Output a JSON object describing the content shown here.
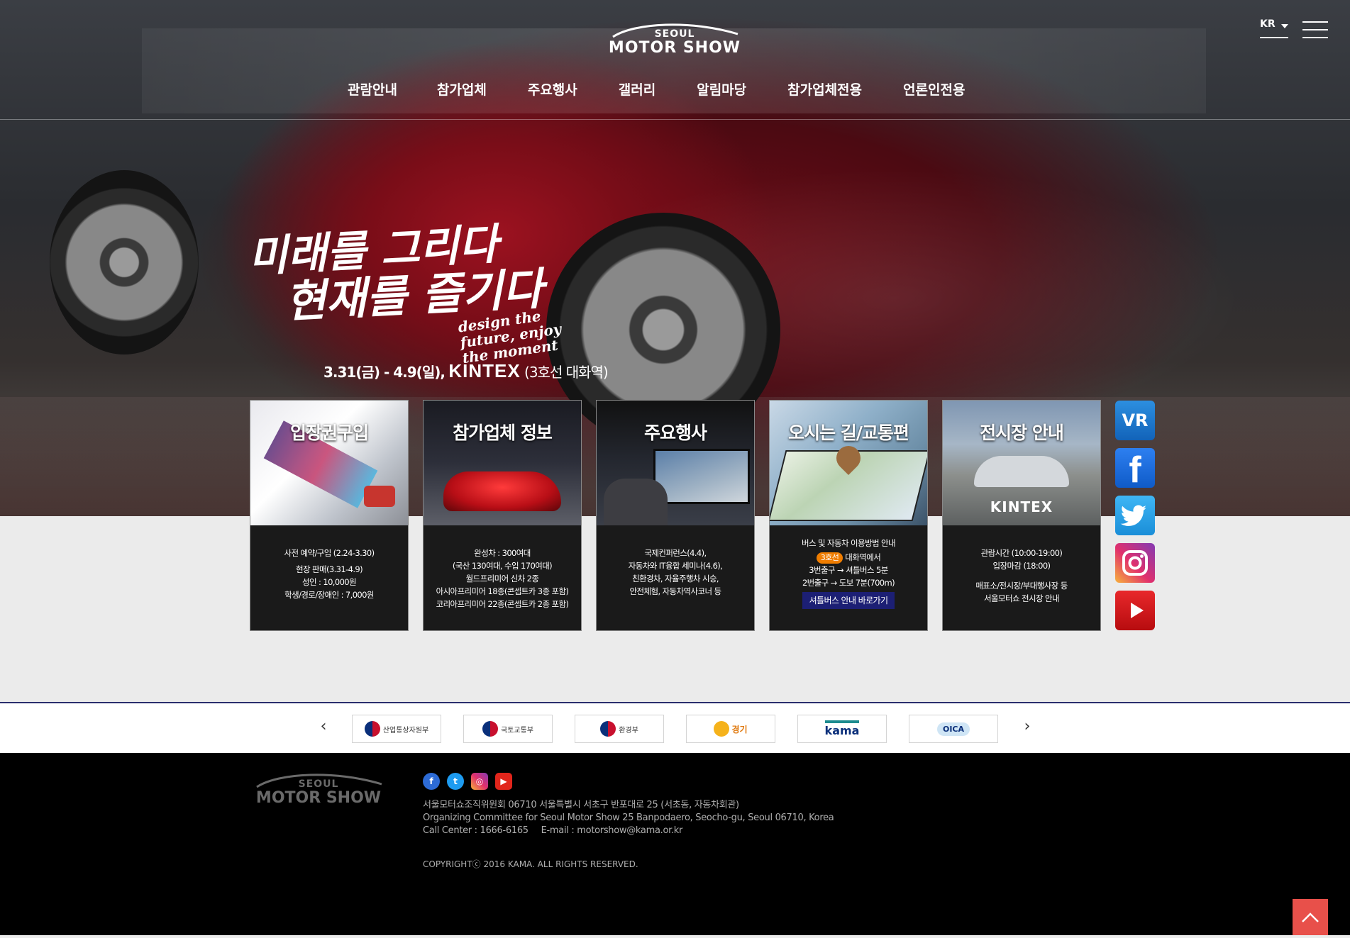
{
  "header": {
    "logo_top": "SEOUL",
    "logo_bottom": "MOTOR SHOW",
    "lang": "KR",
    "nav": [
      "관람안내",
      "참가업체",
      "주요행사",
      "갤러리",
      "알림마당",
      "참가업체전용",
      "언론인전용"
    ]
  },
  "hero": {
    "tagline_line1": "미래를 그리다",
    "tagline_line2": "현재를 즐기다",
    "tagline_en": "design the future, enjoy the moment",
    "date_text": "3.31(금) - 4.9(일),",
    "venue": "KINTEX",
    "venue_note": "(3호선 대화역)"
  },
  "cards": [
    {
      "title": "입장권구입",
      "lines": [
        "사전 예약/구입 (2.24-3.30)",
        "",
        "현장 판매(3.31-4.9)",
        "성인 : 10,000원",
        "학생/경로/장애인 : 7,000원"
      ]
    },
    {
      "title": "참가업체 정보",
      "lines": [
        "완성차 : 300여대",
        "(국산 130여대, 수입 170여대)",
        "월드프리미어 신차 2종",
        "아시아프리미어 18종(콘셉트카 3종 포함)",
        "코리아프리미어 22종(콘셉트카 2종 포함)"
      ]
    },
    {
      "title": "주요행사",
      "lines": [
        "국제컨퍼런스(4.4),",
        "자동차와 IT융합 세미나(4.6),",
        "친환경차, 자율주행차 시승,",
        "안전체험, 자동차역사코너 등"
      ]
    },
    {
      "title": "오시는 길/교통편",
      "heading": "버스 및 자동차 이용방법 안내",
      "badge": "3호선",
      "badge_text": "대화역에서",
      "lines": [
        "3번출구 → 셔틀버스 5분",
        "2번출구 → 도보 7분(700m)"
      ],
      "button": "셔틀버스 안내 바로가기"
    },
    {
      "title": "전시장 안내",
      "image_label": "KINTEX",
      "lines": [
        "관람시간 (10:00-19:00)",
        "입장마감 (18:00)",
        "",
        "매표소/전시장/부대행사장 등",
        "서울모터쇼 전시장 안내"
      ]
    }
  ],
  "sns": {
    "vr": "VR",
    "facebook": "f",
    "twitter": "twitter",
    "instagram": "instagram",
    "youtube": "youtube"
  },
  "partners": [
    {
      "name": "산업통상자원부",
      "type": "gov"
    },
    {
      "name": "국토교통부",
      "type": "gov"
    },
    {
      "name": "환경부",
      "type": "gov"
    },
    {
      "name": "경기",
      "type": "gyeonggi"
    },
    {
      "name": "kama",
      "type": "kama"
    },
    {
      "name": "OICA",
      "type": "oica"
    }
  ],
  "footer": {
    "logo_top": "SEOUL",
    "logo_bottom": "MOTOR SHOW",
    "addr_kr": "서울모터쇼조직위원회 06710 서울특별시 서초구 반포대로 25 (서초동, 자동차회관)",
    "addr_en": "Organizing Committee for Seoul Motor Show 25 Banpodaero, Seocho-gu, Seoul 06710, Korea",
    "call": "Call Center : 1666-6165",
    "email": "E-mail : motorshow@kama.or.kr",
    "copyright": "COPYRIGHTⓒ 2016 KAMA. ALL RIGHTS RESERVED."
  },
  "colors": {
    "accent_orange": "#ef7d00",
    "shuttle_navy": "#1c1f74",
    "top_button": "#e8504a",
    "partner_border": "#2a2e6e"
  }
}
